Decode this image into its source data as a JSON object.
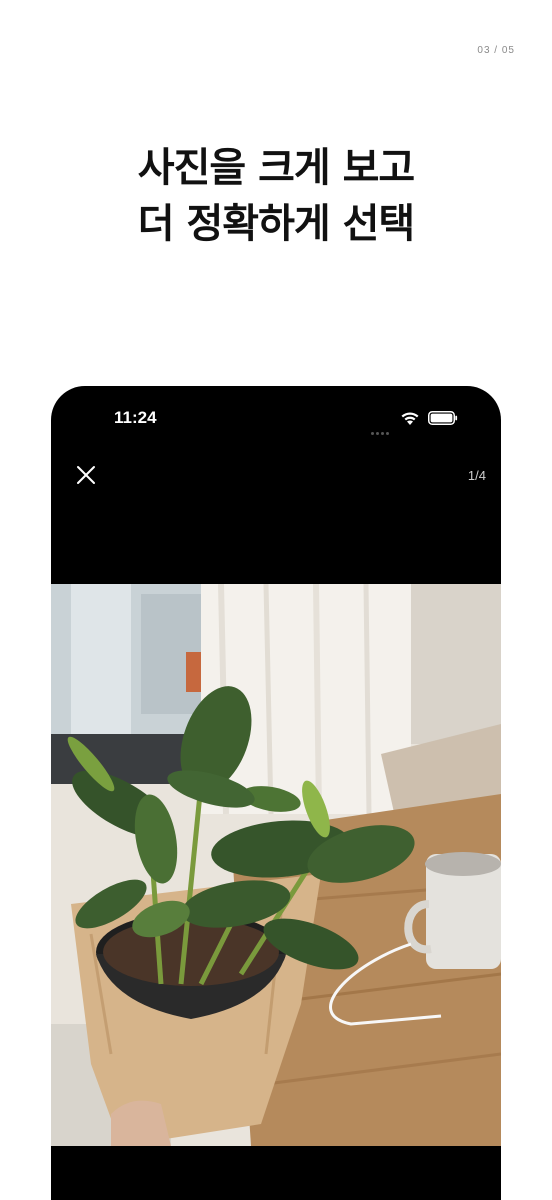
{
  "page_indicator": "03 / 05",
  "headline": {
    "line1": "사진을 크게 보고",
    "line2": "더 정확하게 선택"
  },
  "phone": {
    "status_bar": {
      "time": "11:24",
      "icons": [
        "signal-dots-icon",
        "wifi-icon",
        "battery-icon"
      ]
    },
    "viewer": {
      "close_icon": "close-icon",
      "counter": "1/4"
    },
    "photo": {
      "subject": "potted-plant-photo"
    }
  },
  "colors": {
    "background": "#ffffff",
    "phone_bg": "#000000",
    "headline": "#111111"
  }
}
